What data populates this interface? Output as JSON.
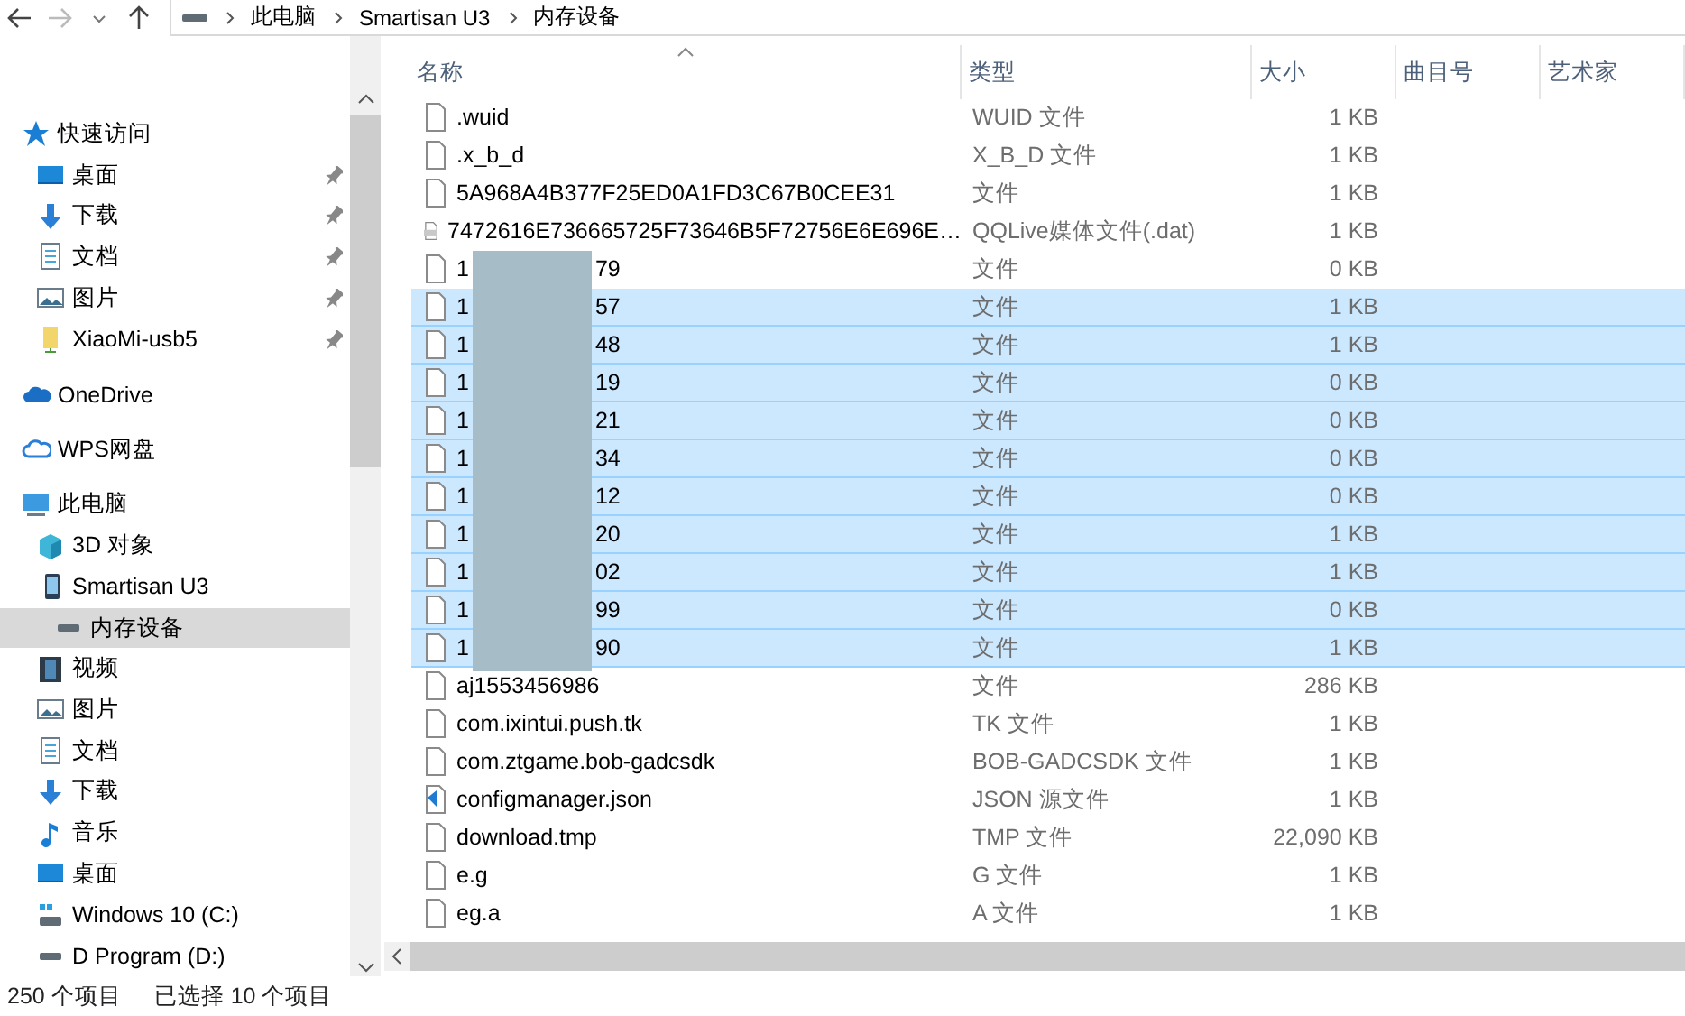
{
  "address_bar": {
    "crumbs": [
      "此电脑",
      "Smartisan U3",
      "内存设备"
    ]
  },
  "nav_pane": {
    "groups": [
      {
        "label": "快速访问",
        "kind": "star",
        "selected": false,
        "children": [
          {
            "label": "桌面",
            "kind": "desktop",
            "pinned": true,
            "selected": false
          },
          {
            "label": "下载",
            "kind": "download",
            "pinned": true,
            "selected": false
          },
          {
            "label": "文档",
            "kind": "document",
            "pinned": true,
            "selected": false
          },
          {
            "label": "图片",
            "kind": "picture",
            "pinned": true,
            "selected": false
          },
          {
            "label": "XiaoMi-usb5",
            "kind": "folder",
            "pinned": true,
            "selected": false
          }
        ]
      },
      {
        "label": "OneDrive",
        "kind": "cloud",
        "selected": false
      },
      {
        "label": "WPS网盘",
        "kind": "cloud-outline",
        "selected": false
      },
      {
        "label": "此电脑",
        "kind": "pc",
        "selected": false,
        "children": [
          {
            "label": "3D 对象",
            "kind": "cube",
            "selected": false
          },
          {
            "label": "Smartisan U3",
            "kind": "phone",
            "selected": false,
            "children": [
              {
                "label": "内存设备",
                "kind": "drive",
                "selected": true
              }
            ]
          },
          {
            "label": "视频",
            "kind": "video",
            "selected": false
          },
          {
            "label": "图片",
            "kind": "picture",
            "selected": false
          },
          {
            "label": "文档",
            "kind": "document",
            "selected": false
          },
          {
            "label": "下载",
            "kind": "download",
            "selected": false
          },
          {
            "label": "音乐",
            "kind": "music",
            "selected": false
          },
          {
            "label": "桌面",
            "kind": "desktop",
            "selected": false
          },
          {
            "label": "Windows 10 (C:)",
            "kind": "windows-drive",
            "selected": false
          },
          {
            "label": "D Program (D:)",
            "kind": "drive",
            "selected": false
          }
        ]
      }
    ]
  },
  "table": {
    "columns": [
      "名称",
      "类型",
      "大小",
      "曲目号",
      "艺术家"
    ],
    "rows": [
      {
        "kind": "file",
        "name": ".wuid",
        "type": "WUID 文件",
        "size": "1 KB",
        "selected": false
      },
      {
        "kind": "file",
        "name": ".x_b_d",
        "type": "X_B_D 文件",
        "size": "1 KB",
        "selected": false
      },
      {
        "kind": "file",
        "name": "5A968A4B377F25ED0A1FD3C67B0CEE31",
        "type": "文件",
        "size": "1 KB",
        "selected": false
      },
      {
        "kind": "vcd",
        "name": "7472616E736665725F73646B5F72756E6E696E…",
        "type": "QQLive媒体文件(.dat)",
        "size": "1 KB",
        "selected": false
      },
      {
        "kind": "redacted",
        "name_start": "1",
        "name_end": "79",
        "type": "文件",
        "size": "0 KB",
        "selected": false
      },
      {
        "kind": "redacted",
        "name_start": "1",
        "name_end": "57",
        "type": "文件",
        "size": "1 KB",
        "selected": true
      },
      {
        "kind": "redacted",
        "name_start": "1",
        "name_end": "48",
        "type": "文件",
        "size": "1 KB",
        "selected": true
      },
      {
        "kind": "redacted",
        "name_start": "1",
        "name_end": "19",
        "type": "文件",
        "size": "0 KB",
        "selected": true
      },
      {
        "kind": "redacted",
        "name_start": "1",
        "name_end": "21",
        "type": "文件",
        "size": "0 KB",
        "selected": true
      },
      {
        "kind": "redacted",
        "name_start": "1",
        "name_end": "34",
        "type": "文件",
        "size": "0 KB",
        "selected": true
      },
      {
        "kind": "redacted",
        "name_start": "1",
        "name_end": "12",
        "type": "文件",
        "size": "0 KB",
        "selected": true
      },
      {
        "kind": "redacted",
        "name_start": "1",
        "name_end": "20",
        "type": "文件",
        "size": "1 KB",
        "selected": true
      },
      {
        "kind": "redacted",
        "name_start": "1",
        "name_end": "02",
        "type": "文件",
        "size": "1 KB",
        "selected": true
      },
      {
        "kind": "redacted",
        "name_start": "1",
        "name_end": "99",
        "type": "文件",
        "size": "0 KB",
        "selected": true
      },
      {
        "kind": "redacted",
        "name_start": "1",
        "name_end": "90",
        "type": "文件",
        "size": "1 KB",
        "selected": true
      },
      {
        "kind": "file",
        "name": "aj1553456986",
        "type": "文件",
        "size": "286 KB",
        "selected": false
      },
      {
        "kind": "file",
        "name": "com.ixintui.push.tk",
        "type": "TK 文件",
        "size": "1 KB",
        "selected": false
      },
      {
        "kind": "file",
        "name": "com.ztgame.bob-gadcsdk",
        "type": "BOB-GADCSDK 文件",
        "size": "1 KB",
        "selected": false
      },
      {
        "kind": "code",
        "name": "configmanager.json",
        "type": "JSON 源文件",
        "size": "1 KB",
        "selected": false
      },
      {
        "kind": "file",
        "name": "download.tmp",
        "type": "TMP 文件",
        "size": "22,090 KB",
        "selected": false
      },
      {
        "kind": "file",
        "name": "e.g",
        "type": "G 文件",
        "size": "1 KB",
        "selected": false
      },
      {
        "kind": "file",
        "name": "eg.a",
        "type": "A 文件",
        "size": "1 KB",
        "selected": false
      }
    ]
  },
  "status_bar": {
    "item_count": "250 个项目",
    "selection": "已选择 10 个项目"
  }
}
